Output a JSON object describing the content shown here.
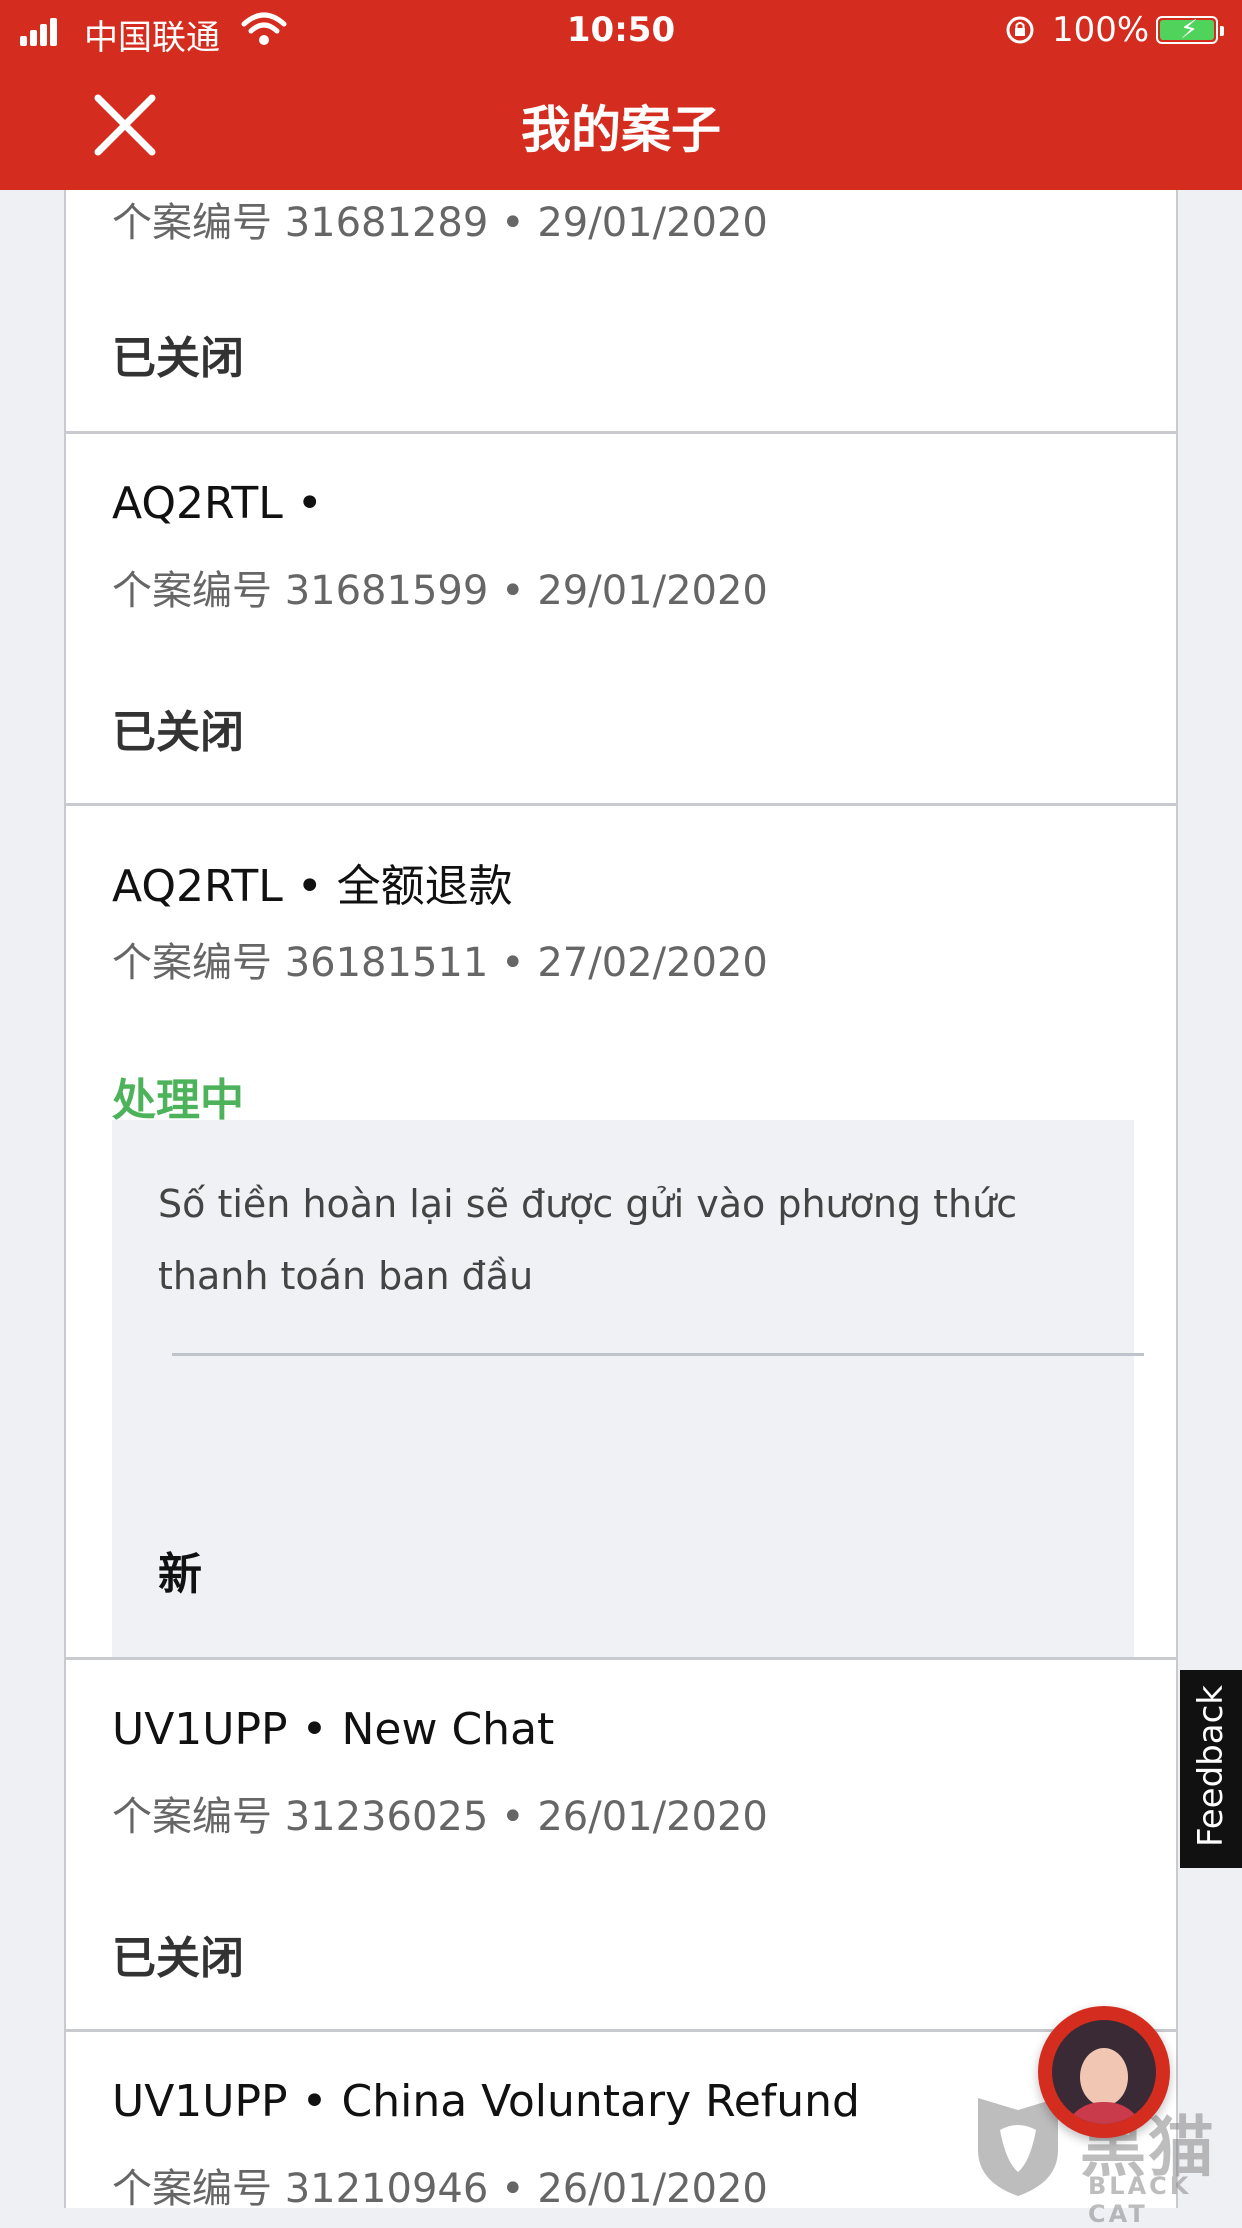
{
  "status_bar": {
    "carrier": "中国联通",
    "time": "10:50",
    "battery": "100%"
  },
  "header": {
    "title": "我的案子"
  },
  "cases": [
    {
      "title": "",
      "meta": "个案编号 31681289 • 29/01/2020",
      "status": "已关闭"
    },
    {
      "title": "AQ2RTL •",
      "meta": "个案编号 31681599 • 29/01/2020",
      "status": "已关闭"
    },
    {
      "title": "AQ2RTL • 全额退款",
      "meta": "个案编号 36181511 • 27/02/2020",
      "status": "处理中",
      "message": {
        "text": "Số tiền hoàn lại sẽ được gửi vào phương thức thanh toán ban đầu",
        "label": "新"
      }
    },
    {
      "title": "UV1UPP • New Chat",
      "meta": "个案编号 31236025 • 26/01/2020",
      "status": "已关闭"
    },
    {
      "title": "UV1UPP • China Voluntary Refund",
      "meta": "个案编号 31210946 • 26/01/2020"
    }
  ],
  "feedback": {
    "label": "Feedback"
  },
  "watermark": {
    "cn": "黑猫",
    "en": "BLACK CAT"
  },
  "colors": {
    "brand_red": "#d42d1f",
    "in_progress_green": "#4db35a",
    "background": "#eff0f4"
  }
}
